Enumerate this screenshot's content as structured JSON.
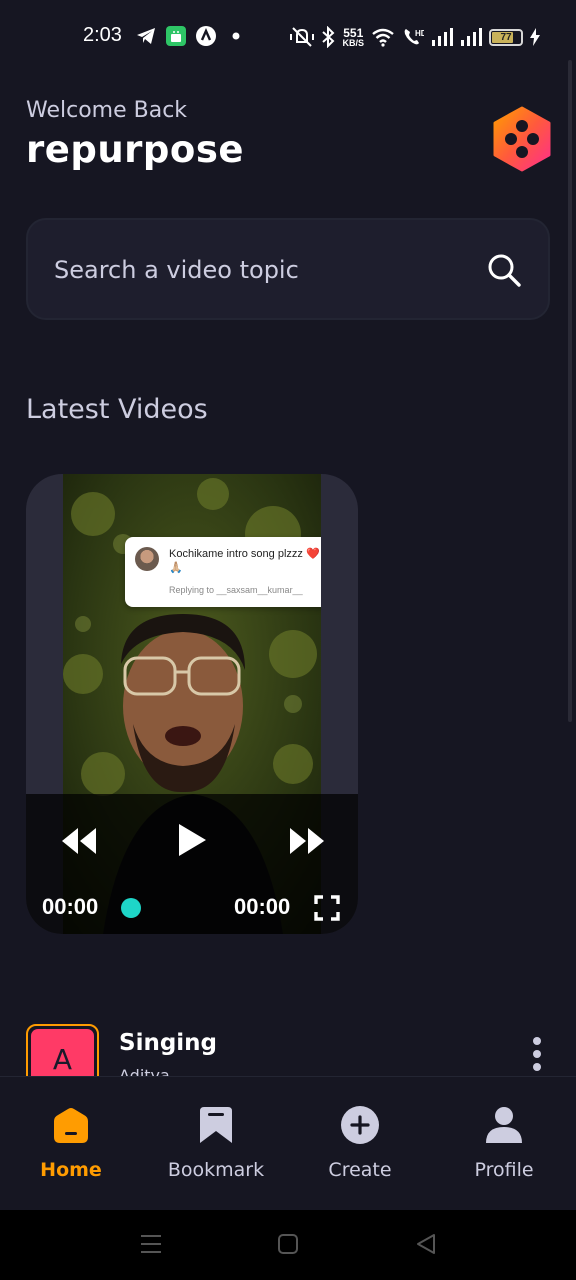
{
  "status_bar": {
    "time": "2:03",
    "net_speed_value": "551",
    "net_speed_unit": "KB/S",
    "battery_level": "77",
    "icons": [
      "telegram-icon",
      "android-app-icon",
      "app-circle-icon",
      "dot-icon",
      "mute-vibrate-icon",
      "bluetooth-icon",
      "wifi-icon",
      "volte-icon",
      "signal-icon",
      "signal-icon",
      "battery-icon",
      "charging-icon"
    ]
  },
  "header": {
    "welcome": "Welcome Back",
    "username": "repurpose",
    "logo_icon": "app-logo-icon"
  },
  "search": {
    "placeholder": "Search a video topic",
    "value": ""
  },
  "latest": {
    "title": "Latest Videos"
  },
  "video": {
    "reply_text": "Kochikame intro song plzzz ❤️🙏🏼",
    "reply_sub": "Replying to __saxsam__kumar__",
    "current_time": "00:00",
    "duration": "00:00",
    "progress": 0,
    "accent_color": "#1ed6c8"
  },
  "list": {
    "items": [
      {
        "thumb_letter": "A",
        "title": "Singing",
        "subtitle": "Aditya"
      }
    ]
  },
  "nav": {
    "items": [
      {
        "label": "Home",
        "icon": "home-icon",
        "active": true
      },
      {
        "label": "Bookmark",
        "icon": "bookmark-icon",
        "active": false
      },
      {
        "label": "Create",
        "icon": "create-icon",
        "active": false
      },
      {
        "label": "Profile",
        "icon": "profile-icon",
        "active": false
      }
    ]
  },
  "colors": {
    "background": "#161622",
    "accent": "#ff9c01",
    "surface": "#1e1e2d",
    "muted_text": "#cdcde0"
  }
}
